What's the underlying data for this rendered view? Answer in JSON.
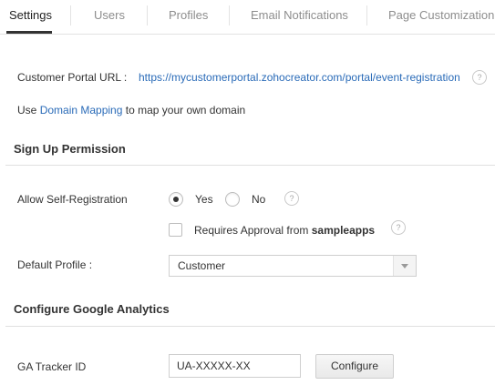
{
  "tabs": [
    {
      "label": "Settings",
      "active": true
    },
    {
      "label": "Users"
    },
    {
      "label": "Profiles"
    },
    {
      "label": "Email Notifications"
    },
    {
      "label": "Page Customization"
    }
  ],
  "portal": {
    "url_label": "Customer Portal URL :",
    "url": "https://mycustomerportal.zohocreator.com/portal/event-registration",
    "help_icon": "?",
    "domain_prefix": "Use",
    "domain_link": "Domain Mapping",
    "domain_suffix": "to map your own domain"
  },
  "signup": {
    "title": "Sign Up Permission",
    "self_reg_label": "Allow Self-Registration",
    "yes_label": "Yes",
    "no_label": "No",
    "selected": "Yes",
    "approval_prefix": "Requires Approval from",
    "approval_app": "sampleapps",
    "default_profile_label": "Default Profile :",
    "default_profile_value": "Customer"
  },
  "analytics": {
    "title": "Configure Google Analytics",
    "tracker_label": "GA Tracker ID",
    "tracker_value": "UA-XXXXX-XX",
    "configure_label": "Configure"
  },
  "colors": {
    "link": "#2a6bb8",
    "text": "#333333",
    "muted_tab": "#8d8d8d"
  }
}
